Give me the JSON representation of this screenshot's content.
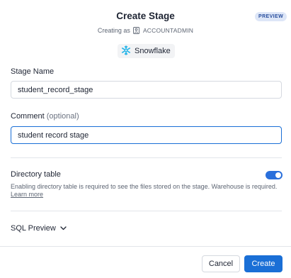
{
  "dialog": {
    "title": "Create Stage",
    "badge": "PREVIEW",
    "creating_as_prefix": "Creating as",
    "role": "ACCOUNTADMIN",
    "database_type": "Snowflake"
  },
  "form": {
    "stage_name": {
      "label": "Stage Name",
      "value": "student_record_stage"
    },
    "comment": {
      "label": "Comment",
      "optional_text": "(optional)",
      "value": "student record stage"
    }
  },
  "directory_table": {
    "title": "Directory table",
    "enabled": true,
    "description": "Enabling directory table is required to see the files stored on the stage. Warehouse is required.",
    "learn_more": "Learn more"
  },
  "sql_preview": {
    "label": "SQL Preview"
  },
  "footer": {
    "cancel_label": "Cancel",
    "create_label": "Create"
  },
  "colors": {
    "primary": "#1a6fd6",
    "badge_bg": "#dde6f7",
    "snowflake": "#29b5e8"
  }
}
